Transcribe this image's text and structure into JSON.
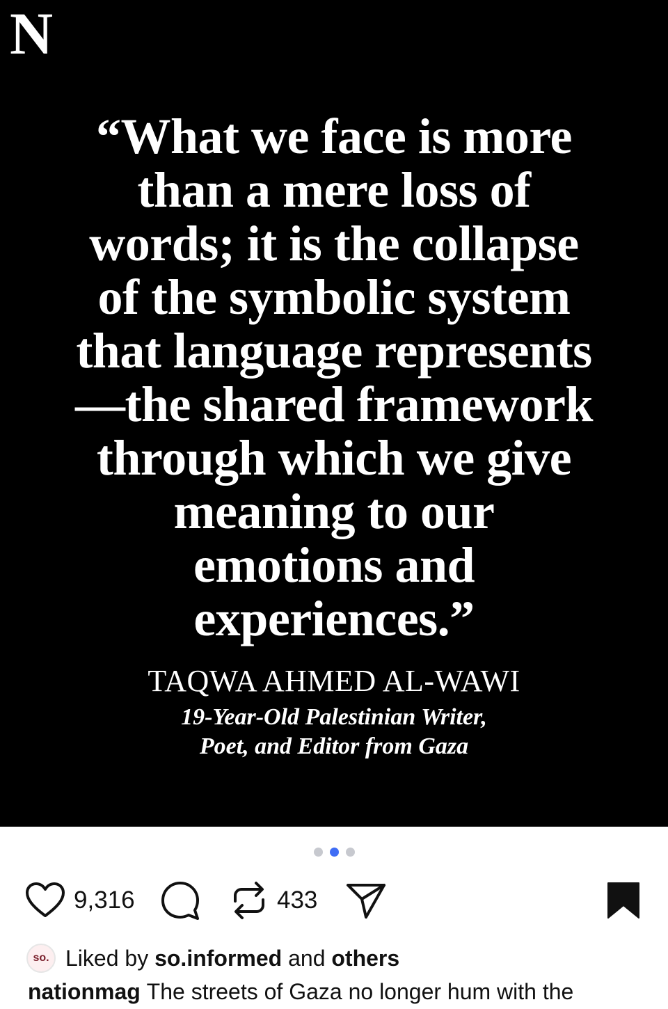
{
  "post_image": {
    "logo": "N",
    "quote_lines": [
      "“What we face is more",
      "than a mere loss of",
      "words; it is the collapse",
      "of the symbolic system",
      "that language represents",
      "—the shared framework",
      "through which we give",
      "meaning to our",
      "emotions and",
      "experiences.”"
    ],
    "author_name": "TAQWA AHMED AL-WAWI",
    "author_desc_lines": [
      "19-Year-Old Palestinian Writer,",
      "Poet, and Editor from Gaza"
    ]
  },
  "carousel": {
    "total": 3,
    "active_index": 1
  },
  "actions": {
    "like_count": "9,316",
    "repost_count": "433",
    "icons": [
      "heart-icon",
      "comment-icon",
      "repost-icon",
      "share-icon",
      "bookmark-icon"
    ]
  },
  "likes": {
    "avatar_text": "so.",
    "prefix": "Liked by",
    "user": "so.informed",
    "conjunction": "and",
    "others": "others"
  },
  "caption": {
    "username": "nationmag",
    "text": "The streets of Gaza no longer hum with the"
  },
  "colors": {
    "image_background": "#000000",
    "active_dot": "#3f6df5",
    "inactive_dot": "#c7c9cf",
    "text": "#111111"
  }
}
